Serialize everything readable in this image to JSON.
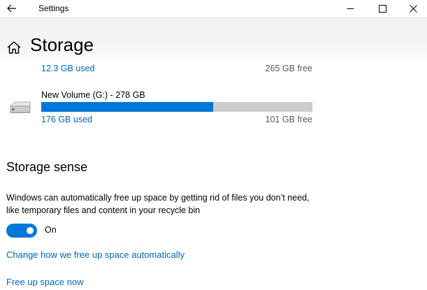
{
  "window": {
    "title": "Settings"
  },
  "header": {
    "title": "Storage"
  },
  "drives": [
    {
      "used_label": "12.3 GB used",
      "free_label": "265 GB free"
    },
    {
      "name": "New Volume (G:) - 278 GB",
      "used_label": "176 GB used",
      "free_label": "101 GB free",
      "used_fraction": 0.633
    }
  ],
  "storage_sense": {
    "title": "Storage sense",
    "description": "Windows can automatically free up space by getting rid of files you don’t need, like temporary files and content in your recycle bin",
    "toggle_state": "On",
    "link_change": "Change how we free up space automatically",
    "link_free_now": "Free up space now"
  },
  "icons": {
    "back": "back-arrow-icon",
    "home": "home-icon",
    "drive": "hard-drive-icon",
    "minimize": "minimize-icon",
    "maximize": "maximize-icon",
    "close": "close-icon"
  },
  "colors": {
    "accent": "#0078d7",
    "link": "#0067c0",
    "bar_track": "#cccccc"
  }
}
